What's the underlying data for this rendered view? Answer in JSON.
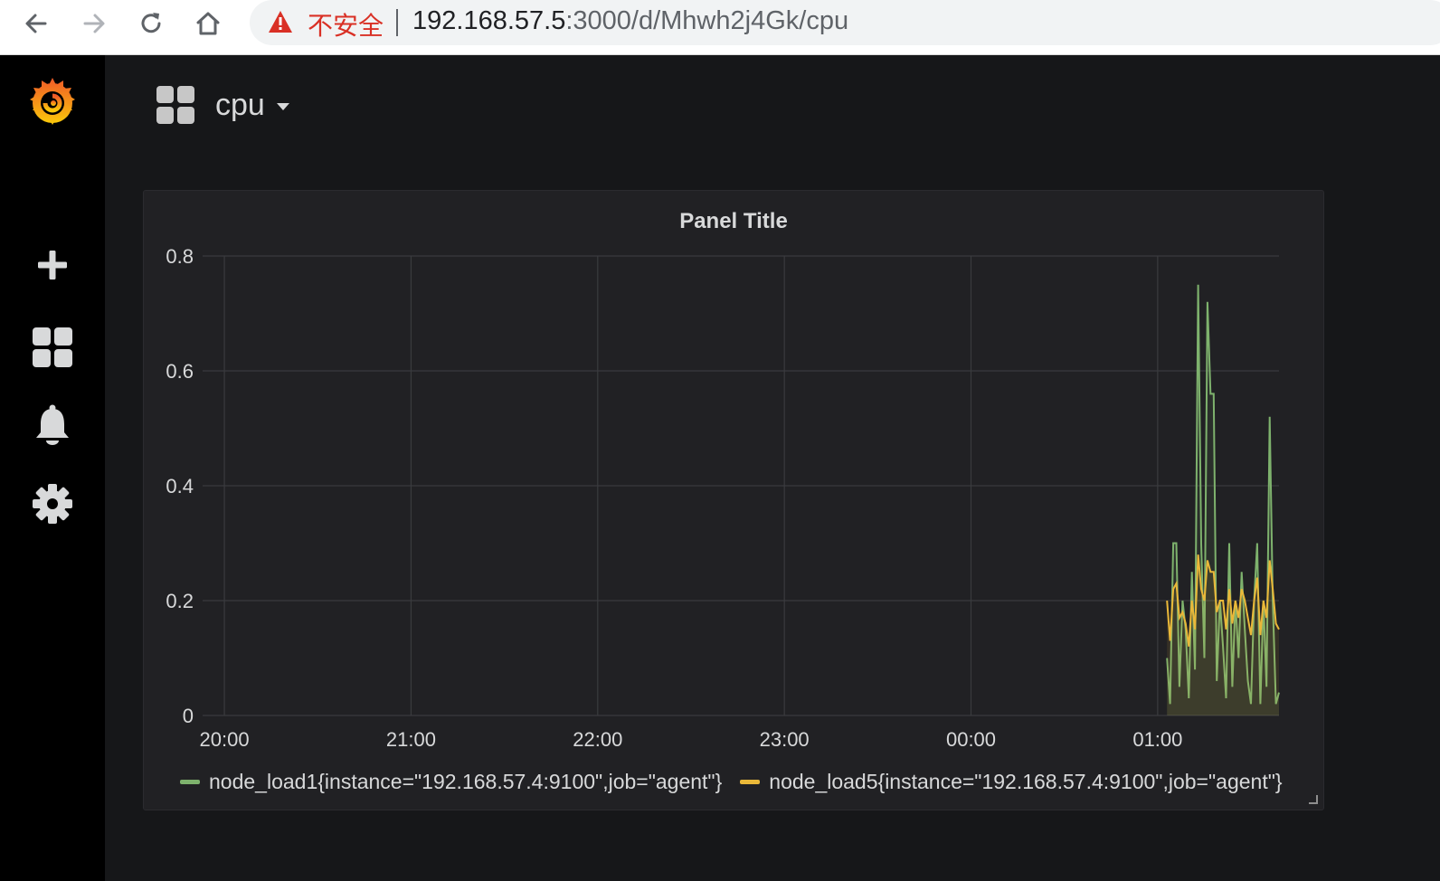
{
  "browser": {
    "security_label": "不安全",
    "url_host": "192.168.57.5",
    "url_path": ":3000/d/Mhwh2j4Gk/cpu"
  },
  "sidebar": {
    "items": [
      {
        "icon": "grafana-logo-icon"
      },
      {
        "icon": "plus-icon"
      },
      {
        "icon": "dashboard-grid-icon"
      },
      {
        "icon": "bell-icon"
      },
      {
        "icon": "gear-icon"
      }
    ]
  },
  "dashboard": {
    "title": "cpu"
  },
  "panel": {
    "title": "Panel Title"
  },
  "colors": {
    "series1": "#7eb26d",
    "series2": "#eab839",
    "grid": "#3a3b3e",
    "text": "#d8d9da"
  },
  "chart_data": {
    "type": "line",
    "title": "Panel Title",
    "ylim": [
      0,
      0.8
    ],
    "y_ticks": [
      "0",
      "0.2",
      "0.4",
      "0.6",
      "0.8"
    ],
    "x_ticks": [
      "20:00",
      "21:00",
      "22:00",
      "23:00",
      "00:00",
      "01:00"
    ],
    "xlim": [
      "19:53",
      "01:39"
    ],
    "grid": true,
    "legend_position": "bottom",
    "x": [
      "01:03",
      "01:04",
      "01:05",
      "01:06",
      "01:07",
      "01:08",
      "01:09",
      "01:10",
      "01:11",
      "01:12",
      "01:13",
      "01:14",
      "01:15",
      "01:16",
      "01:17",
      "01:18",
      "01:19",
      "01:20",
      "01:21",
      "01:22",
      "01:23",
      "01:24",
      "01:25",
      "01:26",
      "01:27",
      "01:28",
      "01:29",
      "01:30",
      "01:31",
      "01:32",
      "01:33",
      "01:34",
      "01:35",
      "01:36",
      "01:37",
      "01:38",
      "01:39"
    ],
    "series": [
      {
        "name": "node_load1{instance=\"192.168.57.4:9100\",job=\"agent\"}",
        "values": [
          0.1,
          0.02,
          0.3,
          0.3,
          0.05,
          0.2,
          0.15,
          0.03,
          0.25,
          0.08,
          0.75,
          0.3,
          0.1,
          0.72,
          0.56,
          0.56,
          0.06,
          0.2,
          0.12,
          0.03,
          0.3,
          0.05,
          0.2,
          0.1,
          0.25,
          0.15,
          0.06,
          0.02,
          0.2,
          0.3,
          0.02,
          0.2,
          0.05,
          0.52,
          0.2,
          0.02,
          0.04
        ]
      },
      {
        "name": "node_load5{instance=\"192.168.57.4:9100\",job=\"agent\"}",
        "values": [
          0.2,
          0.13,
          0.22,
          0.23,
          0.17,
          0.18,
          0.16,
          0.12,
          0.2,
          0.15,
          0.28,
          0.22,
          0.2,
          0.27,
          0.25,
          0.25,
          0.18,
          0.2,
          0.2,
          0.15,
          0.22,
          0.16,
          0.2,
          0.17,
          0.22,
          0.2,
          0.17,
          0.14,
          0.2,
          0.24,
          0.14,
          0.2,
          0.17,
          0.27,
          0.22,
          0.16,
          0.15
        ]
      }
    ]
  }
}
